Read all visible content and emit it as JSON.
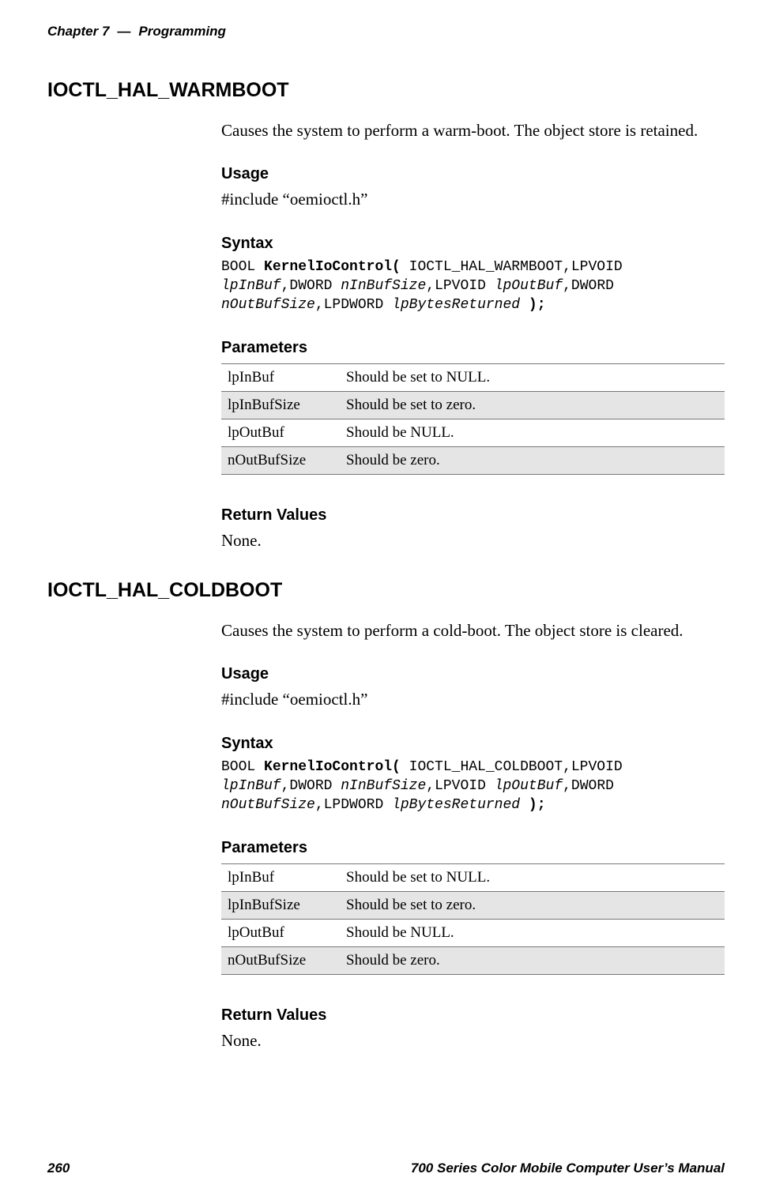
{
  "header": {
    "chapter": "Chapter 7",
    "dash": "—",
    "title": "Programming"
  },
  "sections": [
    {
      "heading": "IOCTL_HAL_WARMBOOT",
      "intro": "Causes the system to perform a warm-boot. The object store is retained.",
      "usage_label": "Usage",
      "usage_text": "#include “oemioctl.h”",
      "syntax_label": "Syntax",
      "syntax": {
        "pre1": "BOOL ",
        "bold1": "KernelIoControl(",
        "mid1": " IOCTL_HAL_WARMBOOT,LPVOID ",
        "it1": "lpInBuf",
        "mid2": ",DWORD ",
        "it2": "nInBufSize",
        "mid3": ",LPVOID ",
        "it3": "lpOutBuf",
        "mid4": ",DWORD ",
        "it4": "nOutBufSize",
        "mid5": ",LPDWORD ",
        "it5": "lpBytesReturned",
        "mid6": " ",
        "bold2": ");"
      },
      "params_label": "Parameters",
      "params": [
        {
          "name": "lpInBuf",
          "desc": "Should be set to NULL."
        },
        {
          "name": "lpInBufSize",
          "desc": "Should be set to zero."
        },
        {
          "name": "lpOutBuf",
          "desc": "Should be NULL."
        },
        {
          "name": "nOutBufSize",
          "desc": "Should be zero."
        }
      ],
      "return_label": "Return Values",
      "return_text": "None."
    },
    {
      "heading": "IOCTL_HAL_COLDBOOT",
      "intro": "Causes the system to perform a cold-boot. The object store is cleared.",
      "usage_label": "Usage",
      "usage_text": "#include “oemioctl.h”",
      "syntax_label": "Syntax",
      "syntax": {
        "pre1": "BOOL ",
        "bold1": "KernelIoControl(",
        "mid1": " IOCTL_HAL_COLDBOOT,LPVOID ",
        "it1": "lpInBuf",
        "mid2": ",DWORD ",
        "it2": "nInBufSize",
        "mid3": ",LPVOID ",
        "it3": "lpOutBuf",
        "mid4": ",DWORD ",
        "it4": "nOutBufSize",
        "mid5": ",LPDWORD ",
        "it5": "lpBytesReturned",
        "mid6": " ",
        "bold2": ");"
      },
      "params_label": "Parameters",
      "params": [
        {
          "name": "lpInBuf",
          "desc": "Should be set to NULL."
        },
        {
          "name": "lpInBufSize",
          "desc": "Should be set to zero."
        },
        {
          "name": "lpOutBuf",
          "desc": "Should be NULL."
        },
        {
          "name": "nOutBufSize",
          "desc": "Should be zero."
        }
      ],
      "return_label": "Return Values",
      "return_text": "None."
    }
  ],
  "footer": {
    "page": "260",
    "manual": "700 Series Color Mobile Computer User’s Manual"
  }
}
